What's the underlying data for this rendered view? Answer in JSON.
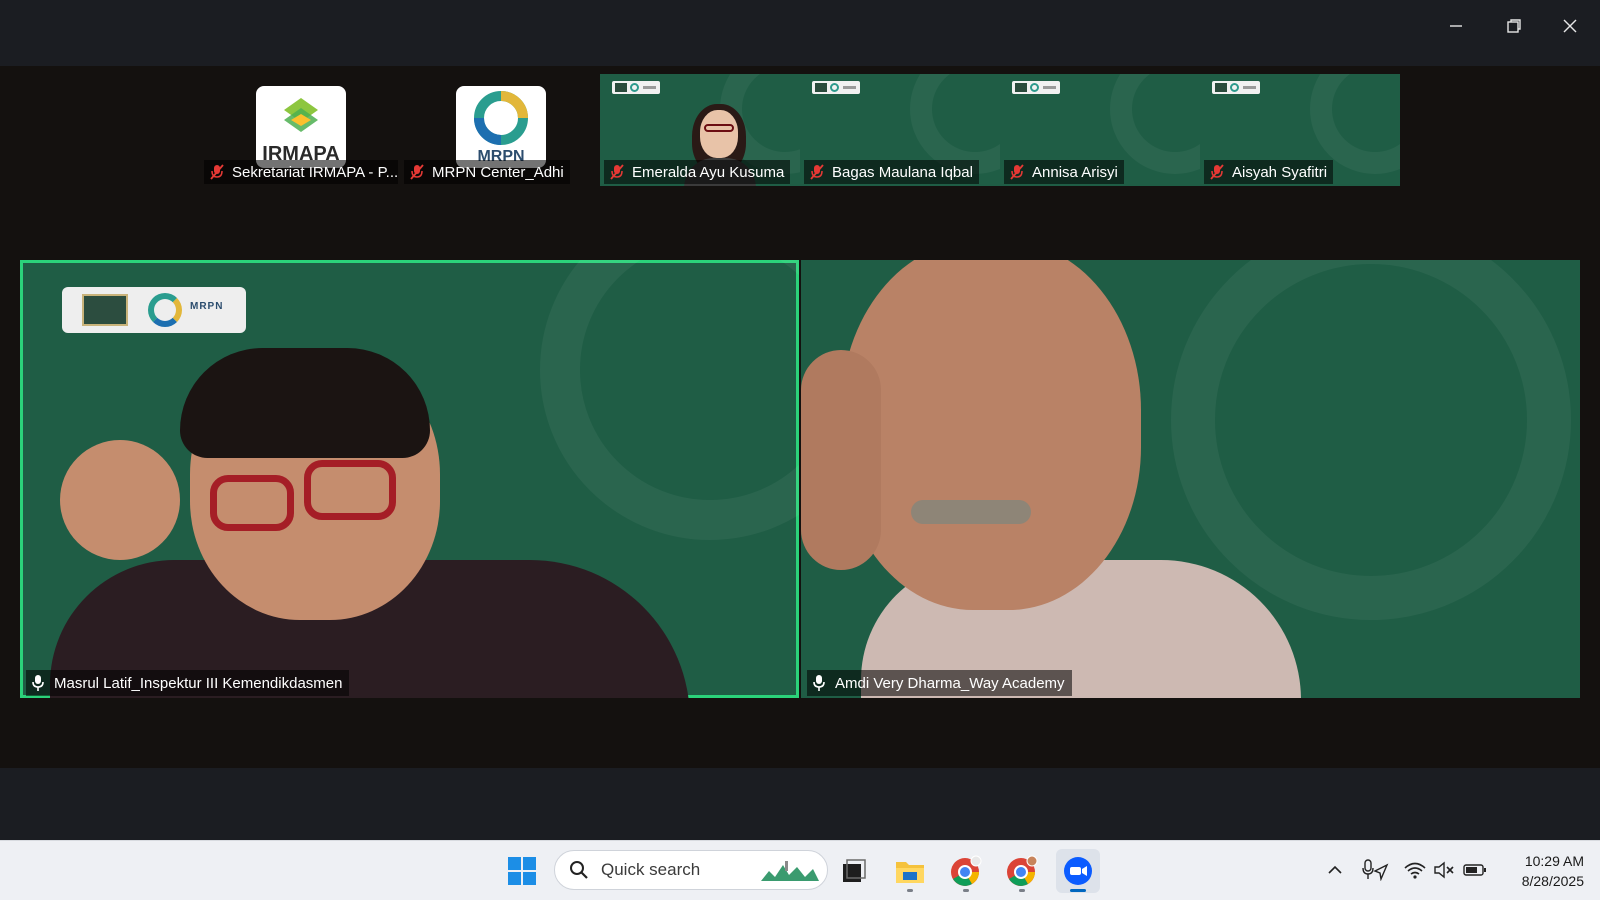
{
  "window": {
    "controls": [
      "minimize",
      "restore",
      "close"
    ]
  },
  "gallery": {
    "participants": [
      {
        "name": "Sekretariat IRMAPA - P...",
        "muted": true,
        "tile": "logo",
        "logo_text": "IRMAPA",
        "logo_icon": "irmapa-logo"
      },
      {
        "name": "MRPN Center_Adhi",
        "muted": true,
        "tile": "logo",
        "logo_text": "MRPN",
        "logo_icon": "mrpn-logo"
      },
      {
        "name": "Emeralda Ayu Kusuma",
        "muted": true,
        "tile": "video"
      },
      {
        "name": "Bagas Maulana Iqbal",
        "muted": true,
        "tile": "video"
      },
      {
        "name": "Annisa Arisyi",
        "muted": true,
        "tile": "video"
      },
      {
        "name": "Aisyah Syafitri",
        "muted": true,
        "tile": "video"
      }
    ]
  },
  "speakers": [
    {
      "name": "Masrul Latif_Inspektur III Kemendikdasmen",
      "active": true,
      "badge_text": "MRPN"
    },
    {
      "name": "Amdi Very Dharma_Way Academy",
      "active": false
    }
  ],
  "colors": {
    "tile_green": "#1f5d45",
    "active_border": "#2bd27a",
    "background": "#1b1d22"
  },
  "taskbar": {
    "search_placeholder": "Quick search",
    "apps": [
      "windows-start",
      "task-view",
      "file-explorer",
      "chrome-profile-1",
      "chrome-profile-2",
      "zoom"
    ],
    "clock": {
      "time": "10:29 AM",
      "date": "8/28/2025"
    },
    "tray": [
      "chevron-up",
      "microphone-location",
      "wifi",
      "speaker-muted",
      "battery"
    ]
  }
}
